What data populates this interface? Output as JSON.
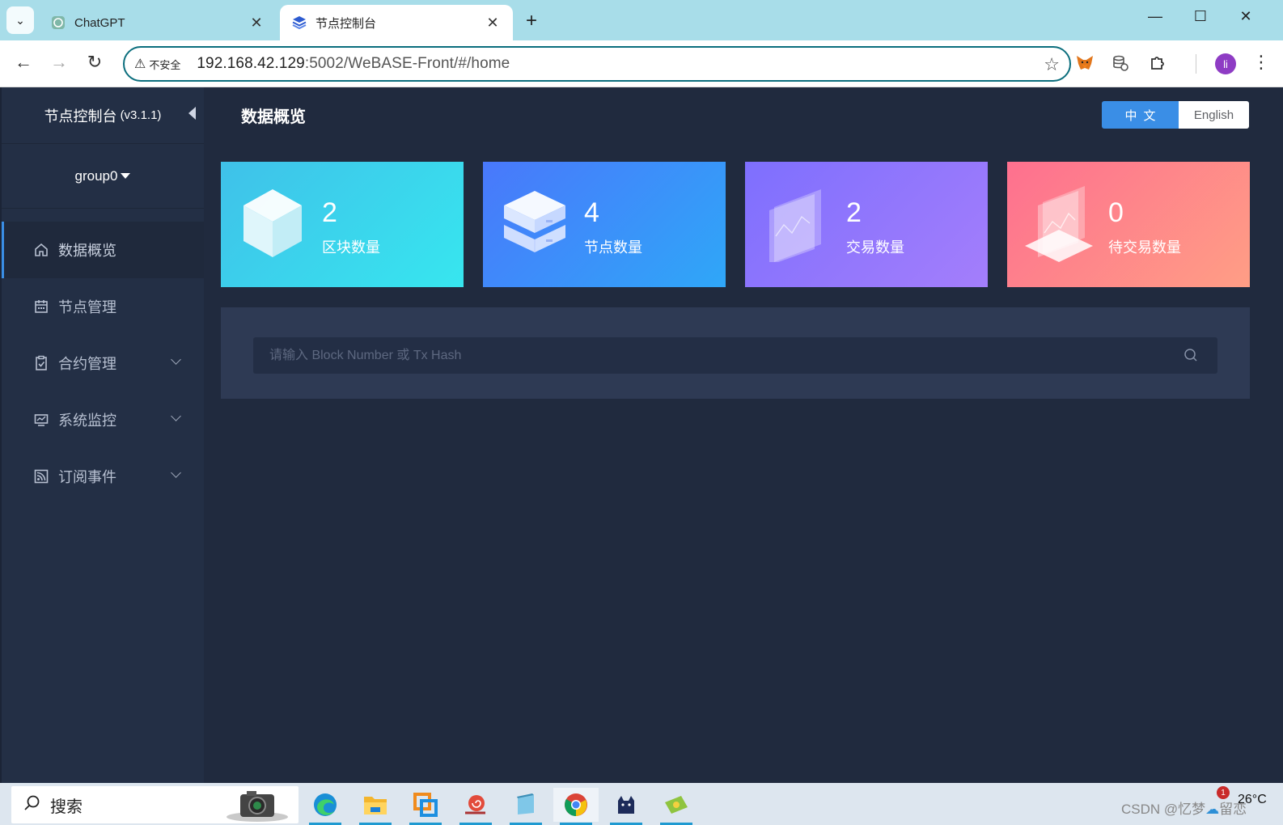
{
  "browser": {
    "tabs": [
      {
        "title": "ChatGPT",
        "active": false
      },
      {
        "title": "节点控制台",
        "active": true
      }
    ],
    "new_tab_symbol": "+",
    "address": {
      "security_label": "不安全",
      "host": "192.168.42.129",
      "path": ":5002/WeBASE-Front/#/home"
    },
    "profile_initial": "li"
  },
  "app": {
    "brand_title": "节点控制台",
    "brand_version": "(v3.1.1)",
    "group": "group0",
    "page_title": "数据概览",
    "language": {
      "zh_label": "中文",
      "en_label": "English",
      "selected": "zh"
    },
    "menu": [
      {
        "label": "数据概览",
        "icon": "home-icon",
        "active": true,
        "expandable": false
      },
      {
        "label": "节点管理",
        "icon": "calendar-icon",
        "active": false,
        "expandable": false
      },
      {
        "label": "合约管理",
        "icon": "clipboard-check-icon",
        "active": false,
        "expandable": true
      },
      {
        "label": "系统监控",
        "icon": "monitor-chart-icon",
        "active": false,
        "expandable": true
      },
      {
        "label": "订阅事件",
        "icon": "rss-icon",
        "active": false,
        "expandable": true
      }
    ],
    "stats": [
      {
        "value": "2",
        "label": "区块数量",
        "icon": "cube-icon",
        "color": "#3fc1e9"
      },
      {
        "value": "4",
        "label": "节点数量",
        "icon": "server-stack-icon",
        "color": "#4978fb"
      },
      {
        "value": "2",
        "label": "交易数量",
        "icon": "transaction-panel-icon",
        "color": "#7e6ffe"
      },
      {
        "value": "0",
        "label": "待交易数量",
        "icon": "pending-tx-panel-icon",
        "color": "#fe708f"
      }
    ],
    "search": {
      "placeholder": "请输入 Block Number 或 Tx Hash",
      "value": ""
    }
  },
  "taskbar": {
    "search_label": "搜索",
    "apps": [
      "camera-app-icon",
      "edge-icon",
      "file-explorer-icon",
      "vmware-icon",
      "snail-app-icon",
      "notepad-icon",
      "chrome-icon",
      "cat-app-icon",
      "money-app-icon"
    ],
    "watermark": "CSDN @忆梦",
    "watermark_tail": "留恋",
    "temperature": "26°C",
    "notification_count": "1"
  }
}
